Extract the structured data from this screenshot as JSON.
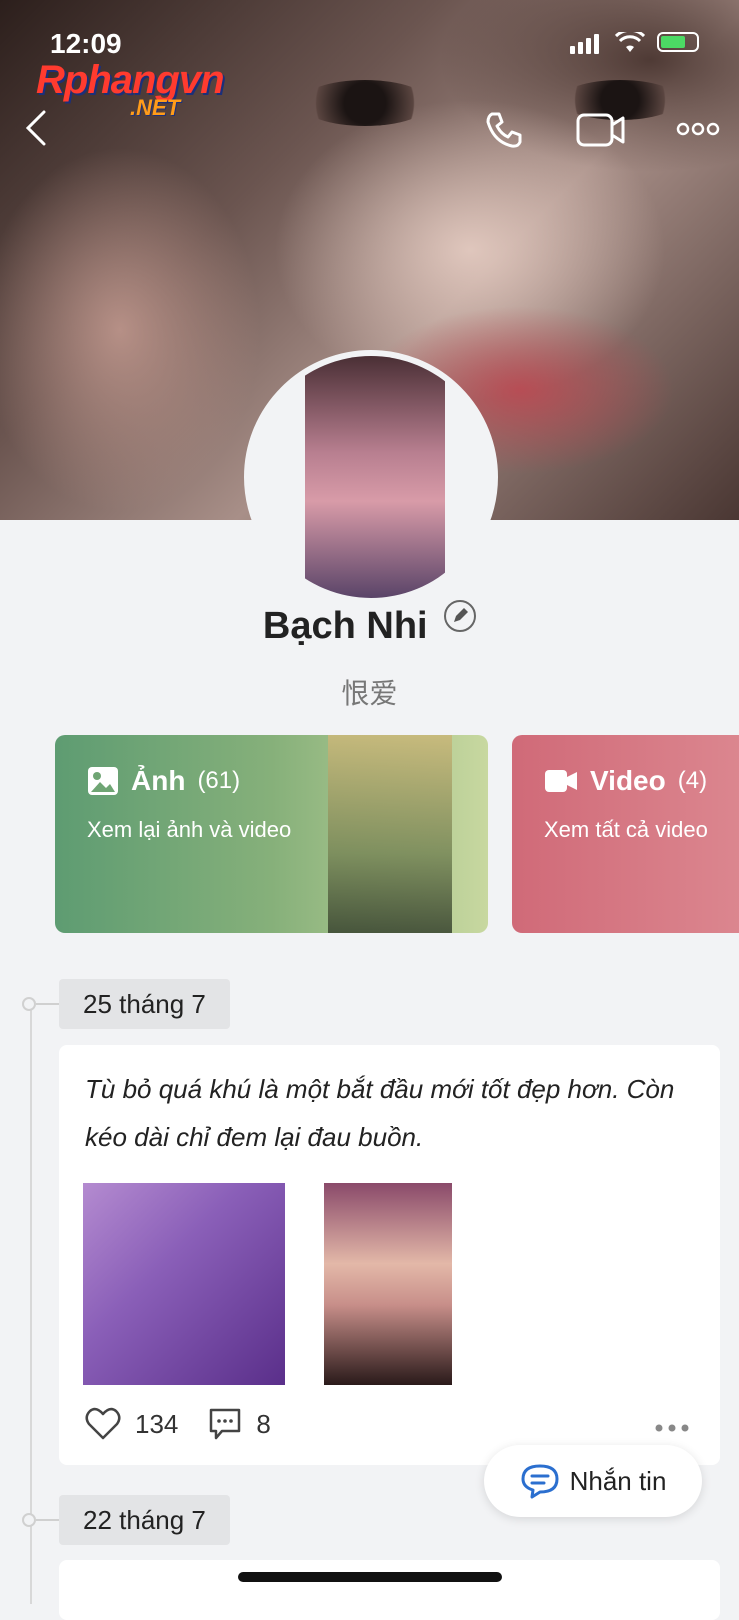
{
  "status_bar": {
    "time": "12:09"
  },
  "watermark": {
    "line1": "Rphangvn",
    "line2": ".NET"
  },
  "profile": {
    "name": "Bạch Nhi",
    "bio": "恨爱"
  },
  "media_cards": {
    "photos": {
      "label": "Ảnh",
      "count": "(61)",
      "subtitle": "Xem lại ảnh và video"
    },
    "videos": {
      "label": "Video",
      "count": "(4)",
      "subtitle": "Xem tất cả video"
    }
  },
  "timeline": [
    {
      "date": "25 tháng 7",
      "post": {
        "text": "Tù bỏ quá khú là một bắt đầu mới tốt đẹp hơn. Còn kéo dài chỉ đem lại đau buồn.",
        "likes": "134",
        "comments": "8"
      }
    },
    {
      "date": "22 tháng 7"
    }
  ],
  "message_button": {
    "label": "Nhắn tin"
  },
  "icons": {
    "back": "chevron-left-icon",
    "call": "phone-icon",
    "video": "video-camera-icon",
    "more": "more-dots-icon",
    "photo": "image-icon",
    "like": "heart-icon",
    "comment": "comment-icon"
  },
  "colors": {
    "photo_card": "#6fa574",
    "video_card": "#d4727e",
    "message_icon": "#2b6fcf"
  }
}
